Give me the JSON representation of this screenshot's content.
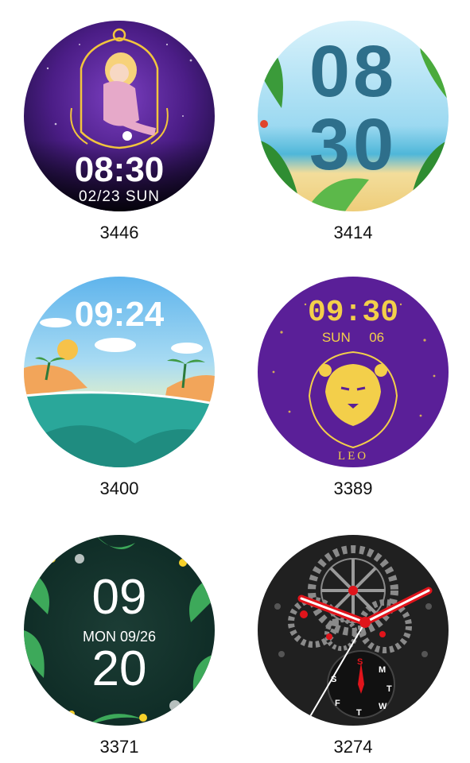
{
  "watch_faces": [
    {
      "id": "3446",
      "time": "08:30",
      "date": "02/23 SUN"
    },
    {
      "id": "3414",
      "hour": "08",
      "minute": "30"
    },
    {
      "id": "3400",
      "time": "09:24"
    },
    {
      "id": "3389",
      "time": "09:30",
      "day": "SUN",
      "date_num": "06",
      "sign": "LEO"
    },
    {
      "id": "3371",
      "hour": "09",
      "date": "MON 09/26",
      "minute": "20"
    },
    {
      "id": "3274",
      "dial_letters": [
        "S",
        "M",
        "T",
        "W",
        "T",
        "F",
        "S"
      ]
    }
  ],
  "colors": {
    "zodiac_purple": "#4b1d86",
    "gold": "#f2c53d",
    "leo_purple": "#5a1f98",
    "leo_yellow": "#f3cf4a",
    "beach_sky": "#9cd9f1",
    "digit_teal": "#2e6f8b",
    "leaf_dark": "#0d2a24",
    "mech_red": "#e0141b"
  }
}
